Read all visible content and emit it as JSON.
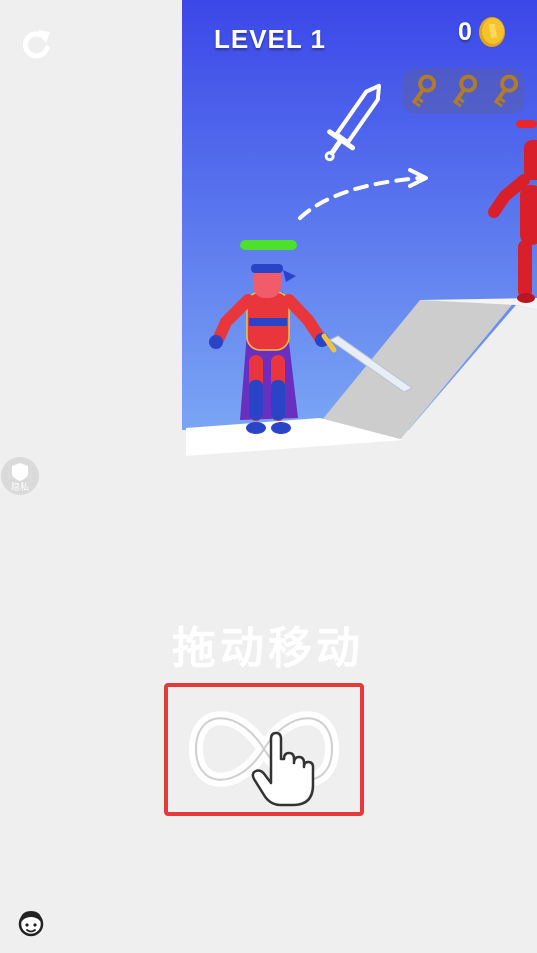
{
  "hud": {
    "level_label": "LEVEL 1",
    "coin_count": "0",
    "keys_collected": 0,
    "keys_total": 3
  },
  "privacy_badge": {
    "label": "隐私"
  },
  "tutorial": {
    "hint_text": "拖动移动"
  },
  "player": {
    "health": 1.0
  },
  "colors": {
    "sky_top": "#3f4fe6",
    "sky_bottom": "#6f9df2",
    "platform": "#ffffff",
    "ramp": "#cfcfcf",
    "player_red": "#e8363c",
    "player_blue": "#2a44c8",
    "cape_purple": "#6b2fc0",
    "enemy_red": "#d81f2a",
    "health_green": "#4de02c",
    "coin_gold": "#f7c22e",
    "tutorial_border": "#e53a3a",
    "background": "#efefef"
  }
}
